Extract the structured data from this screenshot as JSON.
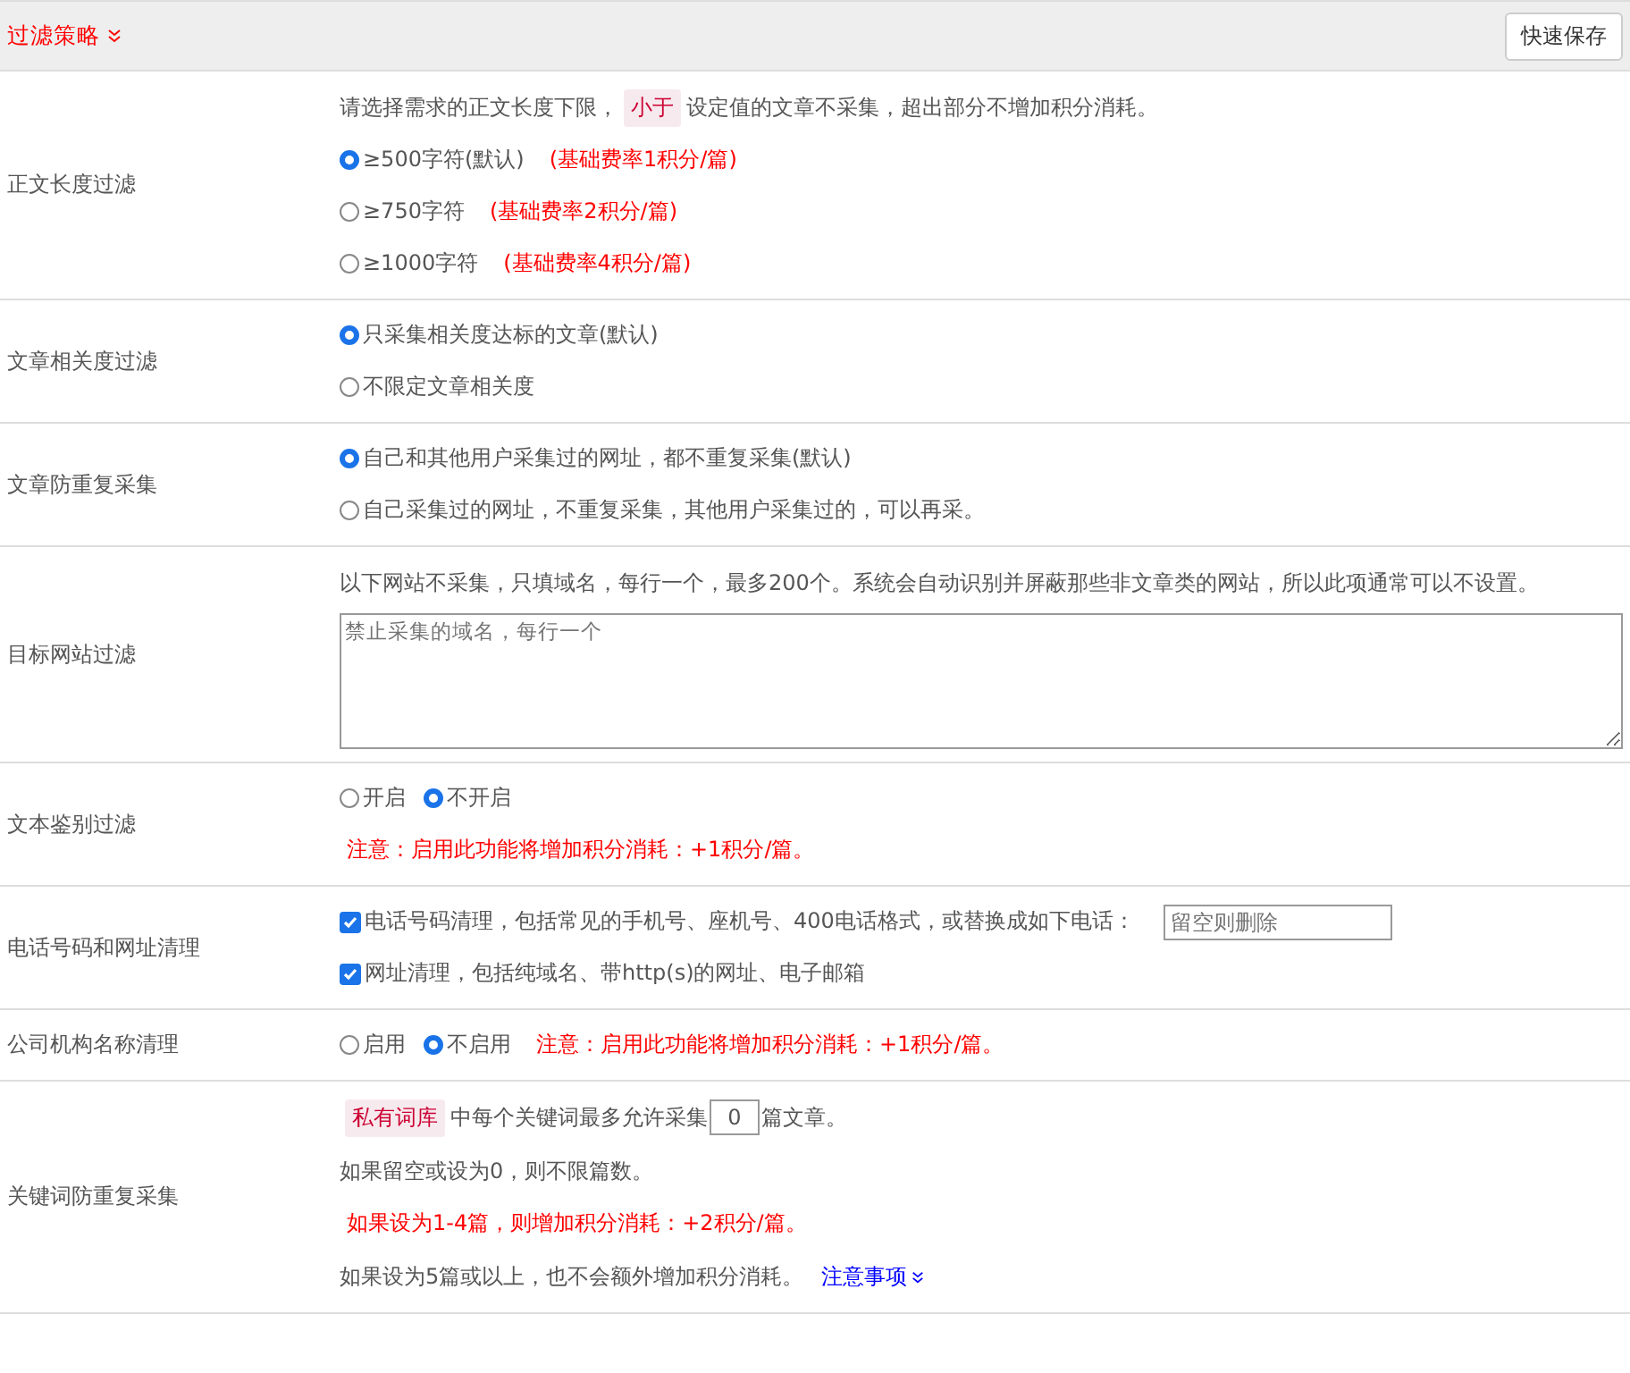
{
  "header": {
    "title": "过滤策略",
    "save_button": "快速保存"
  },
  "rows": [
    {
      "label": "正文长度过滤",
      "lines": [
        [
          {
            "kind": "text",
            "text": "请选择需求的正文长度下限，"
          },
          {
            "kind": "tag",
            "text": "小于"
          },
          {
            "kind": "text",
            "text": "设定值的文章不采集，超出部分不增加积分消耗。"
          }
        ],
        [
          {
            "kind": "radio",
            "text": "≥500字符(默认)",
            "selected": true
          },
          {
            "kind": "red",
            "text": "(基础费率1积分/篇)"
          }
        ],
        [
          {
            "kind": "radio",
            "text": "≥750字符",
            "selected": false
          },
          {
            "kind": "red",
            "text": "(基础费率2积分/篇)"
          }
        ],
        [
          {
            "kind": "radio",
            "text": "≥1000字符",
            "selected": false
          },
          {
            "kind": "red",
            "text": "(基础费率4积分/篇)"
          }
        ]
      ]
    },
    {
      "label": "文章相关度过滤",
      "lines": [
        [
          {
            "kind": "radio",
            "text": "只采集相关度达标的文章(默认)",
            "selected": true
          }
        ],
        [
          {
            "kind": "radio",
            "text": "不限定文章相关度",
            "selected": false
          }
        ]
      ]
    },
    {
      "label": "文章防重复采集",
      "lines": [
        [
          {
            "kind": "radio",
            "text": "自己和其他用户采集过的网址，都不重复采集(默认)",
            "selected": true
          }
        ],
        [
          {
            "kind": "radio",
            "text": "自己采集过的网址，不重复采集，其他用户采集过的，可以再采。",
            "selected": false
          }
        ]
      ]
    },
    {
      "label": "目标网站过滤",
      "lines": [
        [
          {
            "kind": "text",
            "text": "以下网站不采集，只填域名，每行一个，最多200个。系统会自动识别并屏蔽那些非文章类的网站，所以此项通常可以不设置。"
          }
        ],
        [
          {
            "kind": "textarea",
            "placeholder": "禁止采集的域名，每行一个"
          }
        ]
      ]
    },
    {
      "label": "文本鉴别过滤",
      "lines": [
        [
          {
            "kind": "radio",
            "text": "开启",
            "selected": false
          },
          {
            "kind": "radio",
            "text": "不开启",
            "selected": true
          }
        ],
        [
          {
            "kind": "red",
            "text": "注意：启用此功能将增加积分消耗：+1积分/篇。"
          }
        ]
      ]
    },
    {
      "label": "电话号码和网址清理",
      "lines": [
        [
          {
            "kind": "checkbox",
            "text": "电话号码清理，包括常见的手机号、座机号、400电话格式，或替换成如下电话：",
            "checked": true
          },
          {
            "kind": "input",
            "placeholder": "留空则删除"
          }
        ],
        [
          {
            "kind": "checkbox",
            "text": "网址清理，包括纯域名、带http(s)的网址、电子邮箱",
            "checked": true
          }
        ]
      ]
    },
    {
      "label": "公司机构名称清理",
      "lines": [
        [
          {
            "kind": "radio",
            "text": "启用",
            "selected": false
          },
          {
            "kind": "radio",
            "text": "不启用",
            "selected": true
          },
          {
            "kind": "red",
            "text": "注意：启用此功能将增加积分消耗：+1积分/篇。"
          }
        ]
      ]
    },
    {
      "label": "关键词防重复采集",
      "lines": [
        [
          {
            "kind": "tag",
            "text": "私有词库"
          },
          {
            "kind": "text",
            "text": "中每个关键词最多允许采集"
          },
          {
            "kind": "number",
            "value": "0"
          },
          {
            "kind": "text",
            "text": "篇文章。"
          }
        ],
        [
          {
            "kind": "text",
            "text": "如果留空或设为0，则不限篇数。"
          }
        ],
        [
          {
            "kind": "red",
            "text": "如果设为1-4篇，则增加积分消耗：+2积分/篇。"
          }
        ],
        [
          {
            "kind": "text",
            "text": "如果设为5篇或以上，也不会额外增加积分消耗。"
          },
          {
            "kind": "link",
            "text": "注意事项"
          }
        ]
      ]
    }
  ]
}
